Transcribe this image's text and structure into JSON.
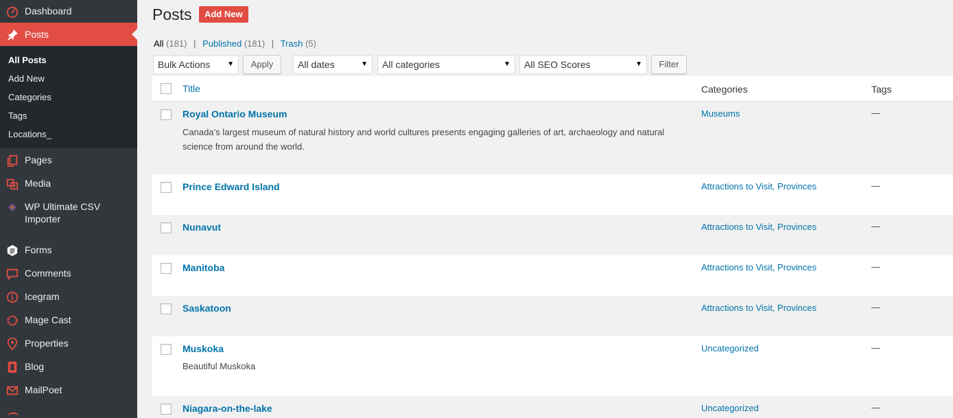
{
  "sidebar": {
    "menu": [
      {
        "label": "Dashboard",
        "icon": "dashboard-icon"
      },
      {
        "label": "Posts",
        "icon": "pushpin-icon",
        "active": true
      },
      {
        "label": "Pages",
        "icon": "pages-icon"
      },
      {
        "label": "Media",
        "icon": "media-icon"
      },
      {
        "label": "WP Ultimate CSV Importer",
        "icon": "csv-importer-icon"
      },
      {
        "label": "Forms",
        "icon": "forms-icon"
      },
      {
        "label": "Comments",
        "icon": "comments-icon"
      },
      {
        "label": "Icegram",
        "icon": "icegram-icon"
      },
      {
        "label": "Mage Cast",
        "icon": "magecast-icon"
      },
      {
        "label": "Properties",
        "icon": "location-pin-icon"
      },
      {
        "label": "Blog",
        "icon": "blog-icon"
      },
      {
        "label": "MailPoet",
        "icon": "mail-icon"
      }
    ],
    "submenu": [
      "All Posts",
      "Add New",
      "Categories",
      "Tags",
      "Locations_"
    ]
  },
  "header": {
    "title": "Posts",
    "add_new": "Add New"
  },
  "filters_links": {
    "all": "All",
    "all_count": "(181)",
    "published": "Published",
    "published_count": "(181)",
    "trash": "Trash",
    "trash_count": "(5)",
    "separator": "|"
  },
  "toolbar": {
    "bulk_actions": "Bulk Actions",
    "apply": "Apply",
    "dates": "All dates",
    "categories": "All categories",
    "seo": "All SEO Scores",
    "filter": "Filter"
  },
  "table": {
    "columns": [
      "Title",
      "Categories",
      "Tags"
    ],
    "rows": [
      {
        "title": "Royal Ontario Museum",
        "excerpt": "Canada’s largest museum of natural history and world cultures presents engaging galleries of art, archaeology and natural science from around the world.",
        "categories": "Museums",
        "tags": "—"
      },
      {
        "title": "Prince Edward Island",
        "excerpt": "",
        "categories": "Attractions to Visit, Provinces",
        "tags": "—"
      },
      {
        "title": "Nunavut",
        "excerpt": "",
        "categories": "Attractions to Visit, Provinces",
        "tags": "—"
      },
      {
        "title": "Manitoba",
        "excerpt": "",
        "categories": "Attractions to Visit, Provinces",
        "tags": "—"
      },
      {
        "title": "Saskatoon",
        "excerpt": "",
        "categories": "Attractions to Visit, Provinces",
        "tags": "—"
      },
      {
        "title": "Muskoka",
        "excerpt": "Beautiful Muskoka",
        "categories": "Uncategorized",
        "tags": "—"
      },
      {
        "title": "Niagara-on-the-lake",
        "excerpt": "",
        "categories": "Uncategorized",
        "tags": "—"
      }
    ]
  },
  "colors": {
    "sidebar_bg": "#32373c",
    "submenu_bg": "#23282d",
    "accent": "#e14d43",
    "link": "#0073aa"
  }
}
